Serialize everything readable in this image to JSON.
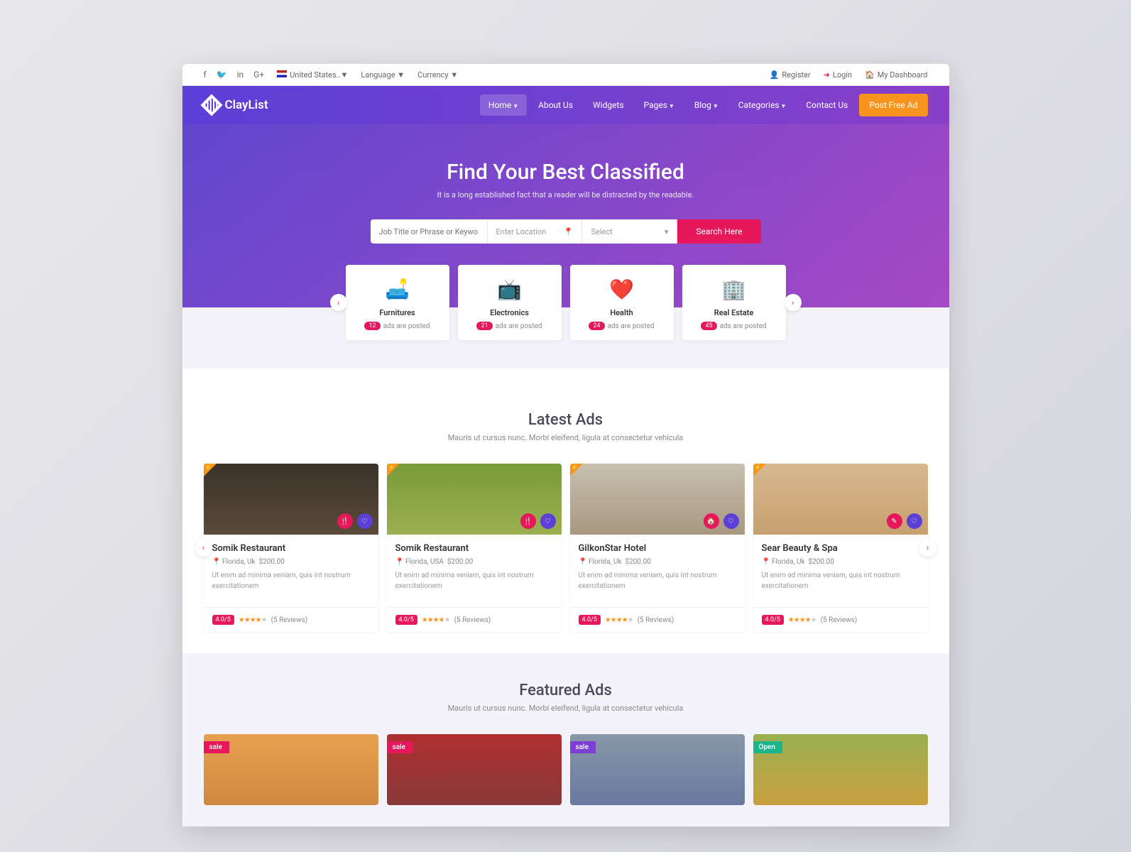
{
  "topbar": {
    "country": "United States..",
    "language": "Language",
    "currency": "Currency",
    "register": "Register",
    "login": "Login",
    "dashboard": "My Dashboard"
  },
  "brand": "ClayList",
  "nav": {
    "home": "Home",
    "about": "About Us",
    "widgets": "Widgets",
    "pages": "Pages",
    "blog": "Blog",
    "categories": "Categories",
    "contact": "Contact Us",
    "post": "Post Free Ad"
  },
  "hero": {
    "title": "Find Your Best Classified",
    "subtitle": "It is a long established fact that a reader will be distracted by the readable.",
    "keywords_ph": "Job Title or Phrase or Keywords",
    "location_ph": "Enter Location",
    "select_ph": "Select",
    "search": "Search Here"
  },
  "categories": [
    {
      "icon": "🛋️",
      "name": "Furnitures",
      "count": "12",
      "suffix": "ads are posted"
    },
    {
      "icon": "📺",
      "name": "Electronics",
      "count": "21",
      "suffix": "ads are posted"
    },
    {
      "icon": "❤️",
      "name": "Health",
      "count": "24",
      "suffix": "ads are posted"
    },
    {
      "icon": "🏢",
      "name": "Real Estate",
      "count": "45",
      "suffix": "ads are posted"
    }
  ],
  "latest": {
    "title": "Latest Ads",
    "subtitle": "Mauris ut cursus nunc. Morbi eleifend, ligula at consectetur vehicula",
    "items": [
      {
        "title": "Somik Restaurant",
        "loc": "Florida, Uk",
        "price": "$200.00",
        "desc": "Ut enim ad minima veniam, quis int nostrum exercitationem",
        "rating": "4.0/5",
        "reviews": "(5 Reviews)"
      },
      {
        "title": "Somik Restaurant",
        "loc": "Florida, USA",
        "price": "$200.00",
        "desc": "Ut enim ad minima veniam, quis int nostrum exercitationem",
        "rating": "4.0/5",
        "reviews": "(5 Reviews)"
      },
      {
        "title": "GilkonStar Hotel",
        "loc": "Florida, Uk",
        "price": "$200.00",
        "desc": "Ut enim ad minima veniam, quis int nostrum exercitationem",
        "rating": "4.0/5",
        "reviews": "(5 Reviews)"
      },
      {
        "title": "Sear Beauty & Spa",
        "loc": "Florida, Uk",
        "price": "$200.00",
        "desc": "Ut enim ad minima veniam, quis int nostrum exercitationem",
        "rating": "4.0/5",
        "reviews": "(5 Reviews)"
      }
    ]
  },
  "featured": {
    "title": "Featured Ads",
    "subtitle": "Mauris ut cursus nunc. Morbi eleifend, ligula at consectetur vehicula",
    "ribbons": [
      "sale",
      "sale",
      "sale",
      "Open"
    ]
  }
}
